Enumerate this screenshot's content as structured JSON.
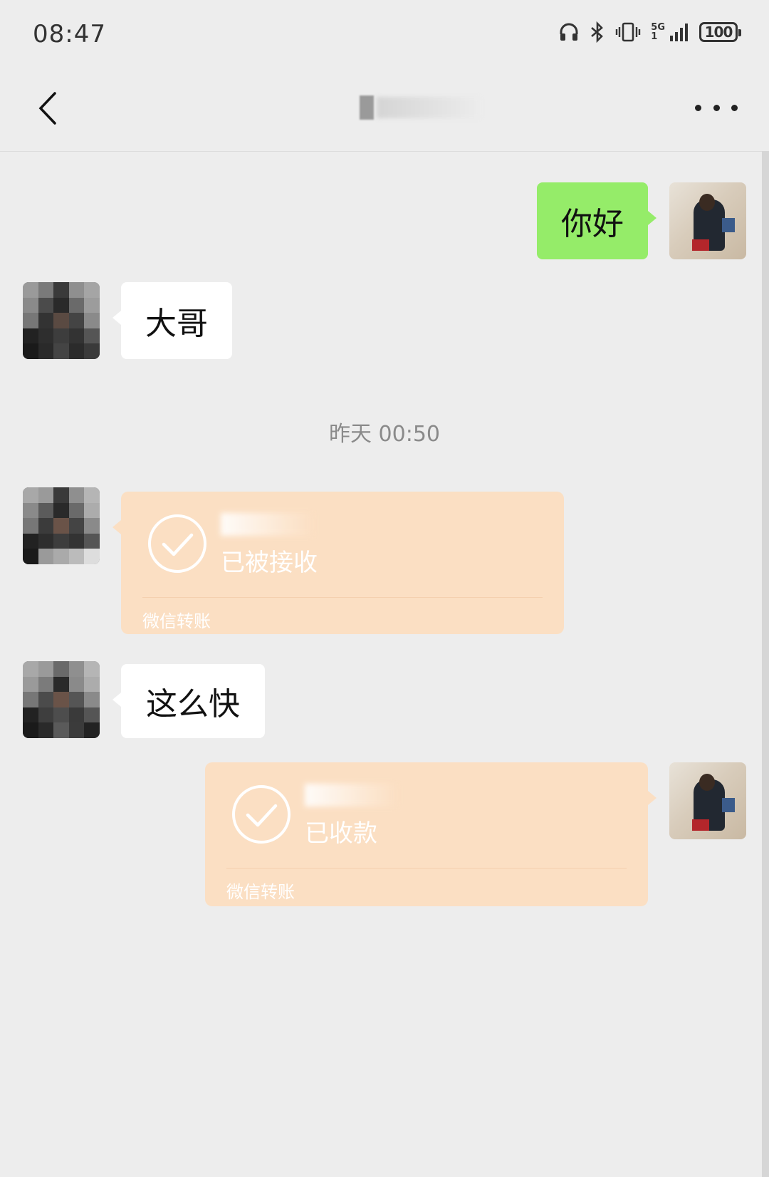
{
  "status_bar": {
    "time": "08:47",
    "network": "5G",
    "network_sub": "1",
    "battery": "100"
  },
  "header": {
    "title": ""
  },
  "colors": {
    "background": "#ededed",
    "outgoing_bubble": "#95ec69",
    "incoming_bubble": "#ffffff",
    "transfer_card": "#fbdfc3"
  },
  "messages": {
    "m1": {
      "direction": "out",
      "text": "你好"
    },
    "m2": {
      "direction": "in",
      "text": "大哥"
    },
    "timestamp": "昨天 00:50",
    "m3": {
      "direction": "in",
      "type": "transfer",
      "status": "已被接收",
      "footer": "微信转账",
      "icon": "check-circle-icon"
    },
    "m4": {
      "direction": "in",
      "text": "这么快"
    },
    "m5": {
      "direction": "out",
      "type": "transfer",
      "status": "已收款",
      "footer": "微信转账",
      "icon": "check-circle-icon"
    }
  },
  "icons": {
    "back": "chevron-left-icon",
    "more": "more-dots-icon",
    "headphones": "headphones-icon",
    "bluetooth": "bluetooth-icon",
    "vibrate": "vibrate-icon",
    "signal": "signal-icon"
  }
}
